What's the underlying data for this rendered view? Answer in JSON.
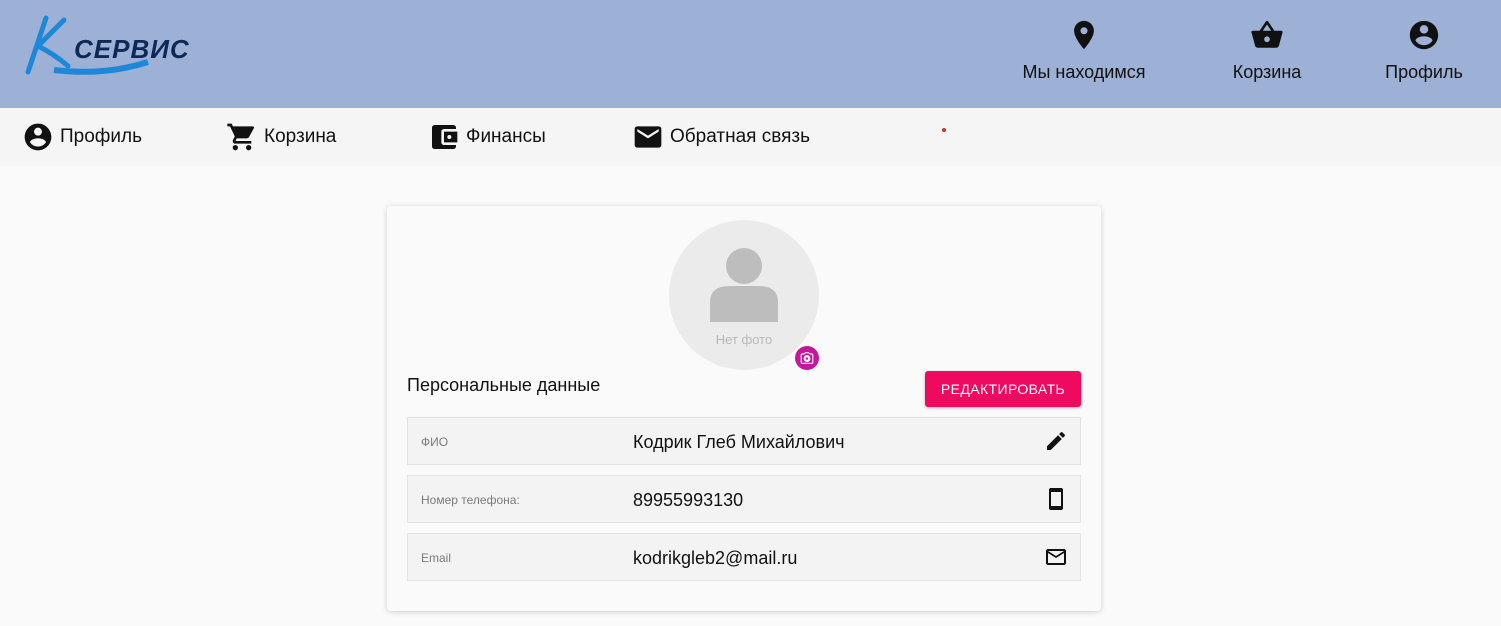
{
  "brand": {
    "logo_text": "СЕРВИС"
  },
  "header": {
    "location_label": "Мы находимся",
    "cart_label": "Корзина",
    "profile_label": "Профиль"
  },
  "nav": {
    "items": [
      {
        "label": "Профиль",
        "icon": "account-circle-icon"
      },
      {
        "label": "Корзина",
        "icon": "cart-icon"
      },
      {
        "label": "Финансы",
        "icon": "wallet-icon"
      },
      {
        "label": "Обратная связь",
        "icon": "mail-icon"
      }
    ]
  },
  "profile": {
    "no_photo": "Нет фото",
    "section_title": "Персональные данные",
    "edit_label": "РЕДАКТИРОВАТЬ",
    "fields": [
      {
        "key": "ФИО",
        "value": "Кодрик Глеб Михайлович",
        "icon": "pencil-icon"
      },
      {
        "key": "Номер телефона:",
        "value": "89955993130",
        "icon": "phone-icon"
      },
      {
        "key": "Email",
        "value": "kodrikgleb2@mail.ru",
        "icon": "mail-icon"
      }
    ]
  },
  "colors": {
    "header_bg": "#9db0d6",
    "accent_pink": "#ef0a60",
    "camera_purple": "#c2189a",
    "logo_blue": "#1e88d8"
  }
}
